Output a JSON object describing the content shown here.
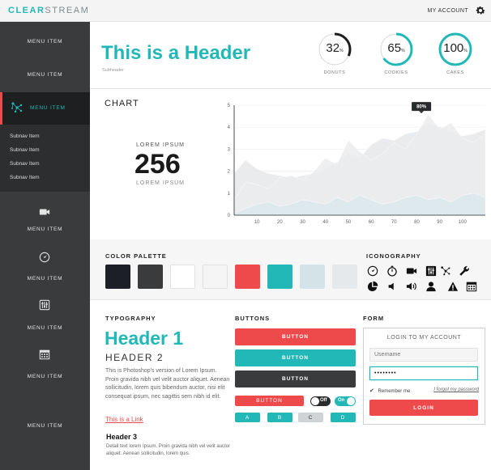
{
  "app": {
    "logo_part1": "CLEAR",
    "logo_part2": "STREAM",
    "account_label": "MY ACCOUNT"
  },
  "sidebar": {
    "items": [
      {
        "label": "MENU ITEM"
      },
      {
        "label": "MENU ITEM"
      },
      {
        "label": "MENU ITEM",
        "active": true
      },
      {
        "label": "MENU ITEM",
        "icon": "video-camera-icon"
      },
      {
        "label": "MENU ITEM",
        "icon": "compass-icon"
      },
      {
        "label": "MENU ITEM",
        "icon": "equalizer-icon"
      },
      {
        "label": "MENU ITEM",
        "icon": "calendar-icon"
      },
      {
        "label": "MENU ITEM"
      }
    ],
    "subnav": [
      "Subnav Item",
      "Subnav Item",
      "Subnav Item",
      "Subnav Item"
    ],
    "active_icon": "network-icon"
  },
  "header": {
    "title": "This is a Header",
    "subheader": "Subheader",
    "donuts": [
      {
        "value": "32",
        "unit": "%",
        "label": "DONUTS",
        "fraction": 0.32,
        "color": "#1d1d1f"
      },
      {
        "value": "65",
        "unit": "%",
        "label": "COOKIES",
        "fraction": 0.65,
        "color": "#22b8b8"
      },
      {
        "value": "100",
        "unit": "%",
        "label": "CAKES",
        "fraction": 1.0,
        "color": "#22b8b8"
      }
    ]
  },
  "chart_section": {
    "title": "CHART",
    "stat_top": "LOREM IPSUM",
    "stat_value": "256",
    "stat_bottom": "LOREM IPSUM"
  },
  "chart_data": {
    "type": "area",
    "x": [
      0,
      5,
      10,
      15,
      20,
      25,
      30,
      35,
      40,
      45,
      50,
      55,
      60,
      65,
      70,
      75,
      80,
      85,
      90,
      95,
      100,
      105,
      110
    ],
    "series": [
      {
        "values": [
          1.9,
          2.5,
          2.1,
          1.9,
          1.8,
          1.7,
          1.8,
          1.9,
          2.1,
          2.4,
          2.8,
          2.6,
          3.2,
          3.5,
          3.4,
          3.7,
          3.8,
          4.2,
          4.0,
          3.8,
          3.6,
          3.7,
          3.9
        ],
        "color": "#e6e8ea"
      },
      {
        "values": [
          0.7,
          1.5,
          1.4,
          1.2,
          1.7,
          1.8,
          1.6,
          2.0,
          2.6,
          2.3,
          3.4,
          2.9,
          2.5,
          2.8,
          3.3,
          3.0,
          3.7,
          4.6,
          3.9,
          4.2,
          3.5,
          3.3,
          3.7
        ],
        "color": "#eaeced"
      },
      {
        "values": [
          0.1,
          0.3,
          0.5,
          0.6,
          0.4,
          0.5,
          0.7,
          0.6,
          0.5,
          0.8,
          0.6,
          0.9,
          0.7,
          0.5,
          0.6,
          0.8,
          0.9,
          0.7,
          0.8,
          0.6,
          0.9,
          1.0,
          0.8
        ],
        "color": "#dbe9ec"
      }
    ],
    "xticks": [
      10,
      20,
      30,
      40,
      50,
      60,
      70,
      80,
      90,
      100
    ],
    "yticks": [
      0,
      1,
      2,
      3,
      4,
      5
    ],
    "xlim": [
      0,
      110
    ],
    "ylim": [
      0,
      5
    ],
    "annotation": {
      "x": 82,
      "y": 4.7,
      "text": "80%"
    },
    "grid": true
  },
  "palette": {
    "title": "COLOR PALETTE",
    "swatches": [
      "#1d1f27",
      "#3a3b3d",
      "#ffffff",
      "#f5f5f5",
      "#ef4a4b",
      "#22b8b8",
      "#d3e3e7",
      "#e6e9ec"
    ]
  },
  "iconography": {
    "title": "ICONOGRAPHY",
    "icons": [
      "compass-icon",
      "stopwatch-icon",
      "video-camera-icon",
      "equalizer-icon",
      "network-icon",
      "wrench-icon",
      "pie-chart-icon",
      "volume-low-icon",
      "volume-high-icon",
      "user-icon",
      "warning-icon",
      "calendar-icon"
    ]
  },
  "typography": {
    "title": "TYPOGRAPHY",
    "h1": "Header 1",
    "h2": "HEADER 2",
    "paragraph": "This is Photoshop's version  of Lorem Ipsum. Proin gravida nibh vel velit auctor aliquet. Aenean sollicitudin, lorem quis bibendum auctor, nisi elit consequat ipsum, nec sagittis sem nibh id elit.",
    "link": "This is a Link",
    "h3": "Header 3",
    "small_paragraph": "Detail text lorem Ipsum. Proin gravida nibh vel velit auctor aliquet. Aenean sollicitudin, lorem quis."
  },
  "buttons": {
    "title": "BUTTONS",
    "primary": "BUTTON",
    "secondary": "BUTTON",
    "dark": "BUTTON",
    "small": "BUTTON",
    "toggle_off": "Off",
    "toggle_on": "On",
    "segments": [
      "A",
      "B",
      "C",
      "D"
    ],
    "colors": {
      "red": "#ef4a4b",
      "teal": "#22b8b8",
      "dark": "#3a3b3d",
      "gray": "#cfd3d6"
    }
  },
  "form": {
    "title": "FORM",
    "box_title": "LOGIN TO MY ACCOUNT",
    "username_placeholder": "Username",
    "password_value": "••••••••",
    "remember_label": "Remember me",
    "forgot_label": "I forgot my password",
    "login_label": "LOGIN"
  }
}
